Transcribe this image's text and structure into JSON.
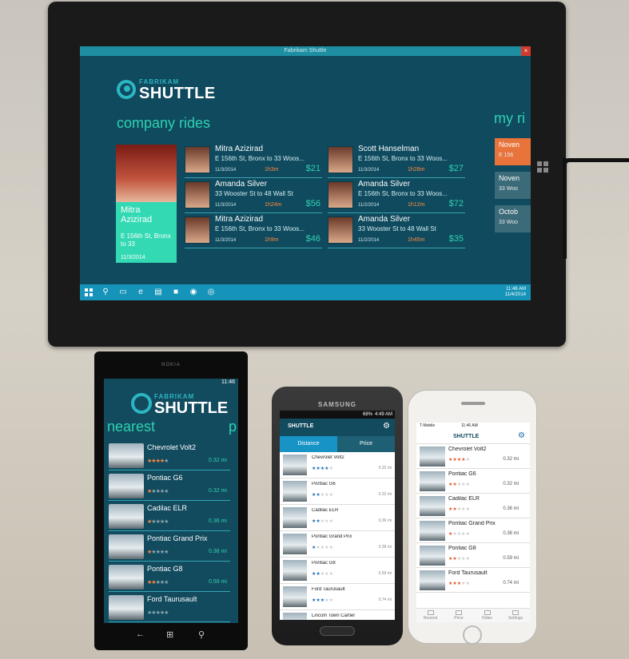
{
  "colors": {
    "accent": "#2fd2b1",
    "brand": "#2bb6c2",
    "screen_bg": "#0f4a5e",
    "highlight": "#ff8a3d"
  },
  "tablet": {
    "window_title": "Fabrikam Shuttle",
    "close_glyph": "×",
    "logo": {
      "sub": "FABRIKAM",
      "main": "SHUTTLE"
    },
    "section_company": "company rides",
    "section_my": "my ri",
    "featured": {
      "name": "Mitra Azizirad",
      "route": "E 156th St, Bronx to 33",
      "date": "11/3/2014"
    },
    "rides": [
      {
        "name": "Mitra Azizirad",
        "route": "E 156th St, Bronx to 33 Woos...",
        "date": "11/3/2014",
        "duration": "1h3m",
        "cost": "$21"
      },
      {
        "name": "Amanda Silver",
        "route": "33 Wooster St to 48 Wall St",
        "date": "11/3/2014",
        "duration": "1h24m",
        "cost": "$56"
      },
      {
        "name": "Mitra Azizirad",
        "route": "E 156th St, Bronx to 33 Woos...",
        "date": "11/3/2014",
        "duration": "1h9m",
        "cost": "$46"
      },
      {
        "name": "Scott Hanselman",
        "route": "E 156th St, Bronx to 33 Woos...",
        "date": "11/3/2014",
        "duration": "1h28m",
        "cost": "$27"
      },
      {
        "name": "Amanda Silver",
        "route": "E 156th St, Bronx to 33 Woos...",
        "date": "11/2/2014",
        "duration": "1h12m",
        "cost": "$72"
      },
      {
        "name": "Amanda Silver",
        "route": "33 Wooster St to 48 Wall St",
        "date": "11/2/2014",
        "duration": "1h45m",
        "cost": "$35"
      }
    ],
    "my_rides": [
      {
        "month": "Noven",
        "addr": "E 156",
        "bg": "#e8743b"
      },
      {
        "month": "Noven",
        "addr": "33 Woo",
        "bg": "#3b6a78"
      },
      {
        "month": "Octob",
        "addr": "33 Woo",
        "bg": "#3b6a78"
      }
    ],
    "taskbar": {
      "icons": [
        {
          "name": "search-icon",
          "glyph": "⚲"
        },
        {
          "name": "task-view-icon",
          "glyph": "▭"
        },
        {
          "name": "ie-icon",
          "glyph": "e"
        },
        {
          "name": "explorer-icon",
          "glyph": "▤"
        },
        {
          "name": "store-icon",
          "glyph": "■"
        },
        {
          "name": "shuttle-app-icon",
          "glyph": "◉"
        },
        {
          "name": "app-icon",
          "glyph": "◎"
        }
      ],
      "time": "11:46 AM",
      "date": "11/4/2014"
    }
  },
  "nokia": {
    "brand": "NOKIA",
    "status_time": "11:46",
    "logo": {
      "sub": "FABRIKAM",
      "main": "SHUTTLE"
    },
    "pivot_nearest": "nearest",
    "pivot_peek": "p",
    "cars": [
      {
        "name": "Chevrolet Volt2",
        "rating": 4,
        "dist": "0.32 mi"
      },
      {
        "name": "Pontiac G6",
        "rating": 1,
        "dist": "0.32 mi"
      },
      {
        "name": "Cadilac ELR",
        "rating": 1,
        "dist": "0.36 mi"
      },
      {
        "name": "Pontiac Grand Prix",
        "rating": 1,
        "dist": "0.38 mi"
      },
      {
        "name": "Pontiac G8",
        "rating": 2,
        "dist": "0.59 mi"
      },
      {
        "name": "Ford Taurusault",
        "rating": 0,
        "dist": ""
      }
    ],
    "nav": {
      "back": "←",
      "windows": "⊞",
      "search": "⚲"
    }
  },
  "samsung": {
    "brand": "SAMSUNG",
    "status_time": "4:49 AM",
    "status_battery": "68%",
    "logo": "SHUTTLE",
    "tab_distance": "Distance",
    "tab_price": "Price",
    "gear": "⚙",
    "cars": [
      {
        "name": "Chevrolet Volt2",
        "rating": 4,
        "dist": "0.32 mi"
      },
      {
        "name": "Pontiac G6",
        "rating": 2,
        "dist": "0.32 mi"
      },
      {
        "name": "Cadilac ELR",
        "rating": 2,
        "dist": "0.36 mi"
      },
      {
        "name": "Pontiac Grand Prix",
        "rating": 1,
        "dist": "0.38 mi"
      },
      {
        "name": "Pontiac G8",
        "rating": 2,
        "dist": "0.59 mi"
      },
      {
        "name": "Ford Taurusault",
        "rating": 3,
        "dist": "0.74 mi"
      },
      {
        "name": "Lincoln Town Cartier",
        "rating": 0,
        "dist": ""
      }
    ]
  },
  "iphone": {
    "carrier": "T-Mobile",
    "status_time": "11:46 AM",
    "logo": "SHUTTLE",
    "gear": "⚙",
    "cars": [
      {
        "name": "Chevrolet Volt2",
        "rating": 4,
        "dist": "0.32 mi"
      },
      {
        "name": "Pontiac G6",
        "rating": 2,
        "dist": "0.32 mi"
      },
      {
        "name": "Cadilac ELR",
        "rating": 2,
        "dist": "0.36 mi"
      },
      {
        "name": "Pontiac Grand Prix",
        "rating": 1,
        "dist": "0.38 mi"
      },
      {
        "name": "Pontiac G8",
        "rating": 2,
        "dist": "0.59 mi"
      },
      {
        "name": "Ford Taurusault",
        "rating": 3,
        "dist": "0.74 mi"
      }
    ],
    "tabs": [
      "Nearest",
      "Price",
      "Rides",
      "Settings"
    ]
  }
}
